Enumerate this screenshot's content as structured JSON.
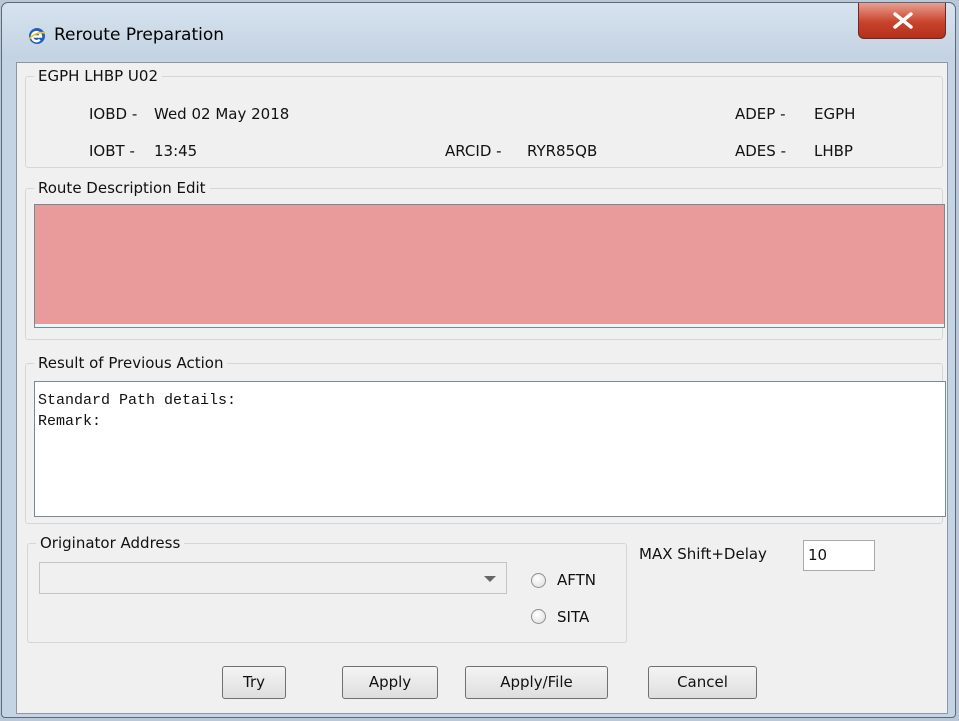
{
  "window": {
    "title": "Reroute Preparation",
    "app_icon": "e-app-icon",
    "close_icon": "close-x-icon"
  },
  "flight": {
    "group_title": "EGPH LHBP U02",
    "iobd_label": "IOBD -",
    "iobd_value": "Wed 02 May 2018",
    "iobt_label": "IOBT -",
    "iobt_value": "13:45",
    "arcid_label": "ARCID -",
    "arcid_value": "RYR85QB",
    "adep_label": "ADEP -",
    "adep_value": "EGPH",
    "ades_label": "ADES -",
    "ades_value": "LHBP"
  },
  "route": {
    "title": "Route Description Edit",
    "value": "",
    "error_color": "#e89b9a"
  },
  "result": {
    "title": "Result of Previous Action",
    "lines": [
      "Standard Path details:",
      "Remark:"
    ]
  },
  "originator": {
    "title": "Originator Address",
    "selected": "",
    "aftn_label": "AFTN",
    "sita_label": "SITA"
  },
  "shift": {
    "label": "MAX Shift+Delay",
    "value": "10"
  },
  "buttons": {
    "try": "Try",
    "apply": "Apply",
    "apply_file": "Apply/File",
    "cancel": "Cancel"
  }
}
